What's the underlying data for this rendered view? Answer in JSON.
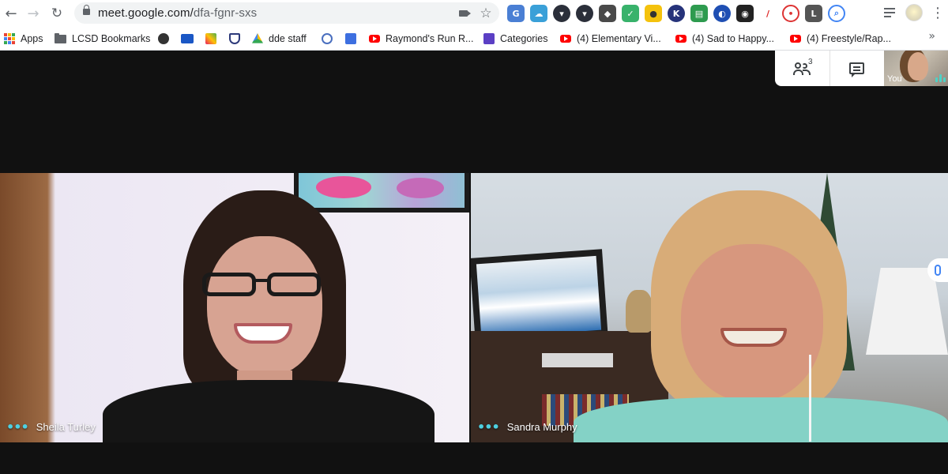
{
  "browser": {
    "url_host": "meet.google.com/",
    "url_path": "dfa-fgnr-sxs",
    "nav": {
      "back_icon": "arrow-left",
      "forward_icon": "arrow-right",
      "reload_icon": "reload"
    }
  },
  "bookmarks": [
    {
      "label": "Apps",
      "icon": "apps-grid-icon"
    },
    {
      "label": "LCSD Bookmarks",
      "icon": "folder-icon"
    },
    {
      "label": "",
      "icon": "globe-icon"
    },
    {
      "label": "",
      "icon": "bookmark-icon"
    },
    {
      "label": "",
      "icon": "bookmark-icon"
    },
    {
      "label": "",
      "icon": "shield-icon"
    },
    {
      "label": "dde staff",
      "icon": "drive-icon"
    },
    {
      "label": "",
      "icon": "bookmark-icon"
    },
    {
      "label": "",
      "icon": "bookmark-icon"
    },
    {
      "label": "Raymond's Run R...",
      "icon": "youtube-icon"
    },
    {
      "label": "Categories",
      "icon": "bookmark-icon"
    },
    {
      "label": "(4) Elementary Vi...",
      "icon": "youtube-icon"
    },
    {
      "label": "(4) Sad to Happy...",
      "icon": "youtube-icon"
    },
    {
      "label": "(4) Freestyle/Rap...",
      "icon": "youtube-icon"
    }
  ],
  "meet": {
    "participant_count": "3",
    "self_label": "You",
    "participants": [
      {
        "name": "Sheila Turley"
      },
      {
        "name": "Sandra Murphy"
      }
    ]
  },
  "colors": {
    "meet_bg": "#111111",
    "accent_teal": "#4dd0e1",
    "youtube_red": "#ff0000"
  }
}
